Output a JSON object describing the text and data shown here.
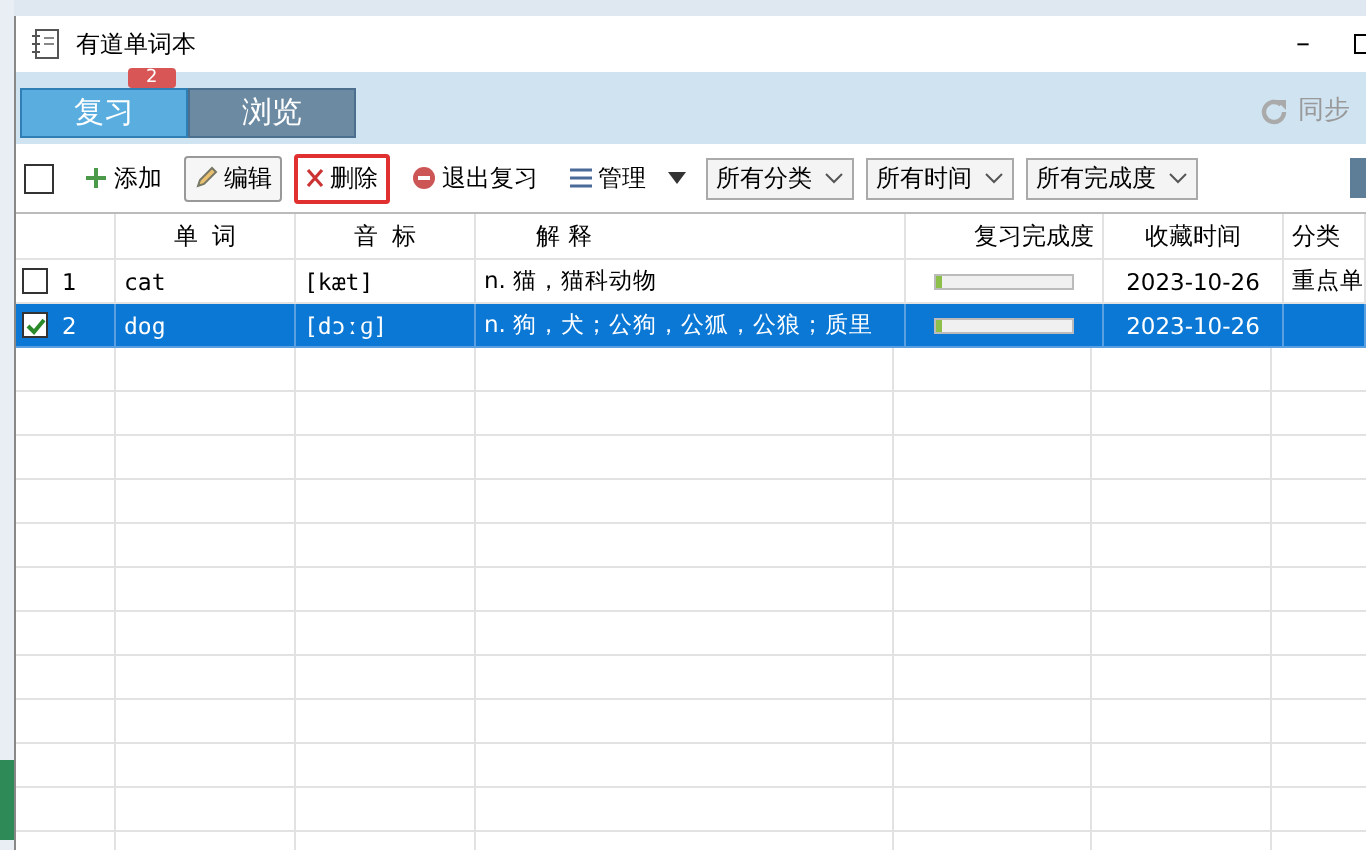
{
  "window": {
    "title": "有道单词本",
    "minimize": "–"
  },
  "tabs": [
    {
      "label": "复习",
      "selected": true,
      "badge": "2"
    },
    {
      "label": "浏览",
      "selected": false
    }
  ],
  "sync": {
    "label": "同步"
  },
  "toolbar": {
    "select_all": {
      "checked": false
    },
    "buttons": [
      {
        "kind": "add",
        "label": "添加",
        "highlighted": false
      },
      {
        "kind": "edit",
        "label": "编辑",
        "highlighted": false
      },
      {
        "kind": "delete",
        "label": "删除",
        "highlighted": true
      },
      {
        "kind": "exit",
        "label": "退出复习",
        "highlighted": false
      },
      {
        "kind": "manage",
        "label": "管理",
        "highlighted": false
      }
    ],
    "filters": [
      "所有分类",
      "所有时间",
      "所有完成度"
    ]
  },
  "table": {
    "columns": [
      "单 词",
      "音 标",
      "解 释",
      "复习完成度",
      "收藏时间",
      "分类"
    ],
    "rows": [
      {
        "index": "1",
        "word": "cat",
        "phonetic": "[kæt]",
        "meaning": "n. 猫，猫科动物",
        "level": 0.05,
        "date": "2023-10-26",
        "category": "重点单",
        "checked": false,
        "selected": false
      },
      {
        "index": "2",
        "word": "dog",
        "phonetic": "[dɔːɡ]",
        "meaning": "n. 狗，犬；公狗，公狐，公狼；质里",
        "level": 0.05,
        "date": "2023-10-26",
        "category": "",
        "checked": true,
        "selected": true
      }
    ]
  }
}
